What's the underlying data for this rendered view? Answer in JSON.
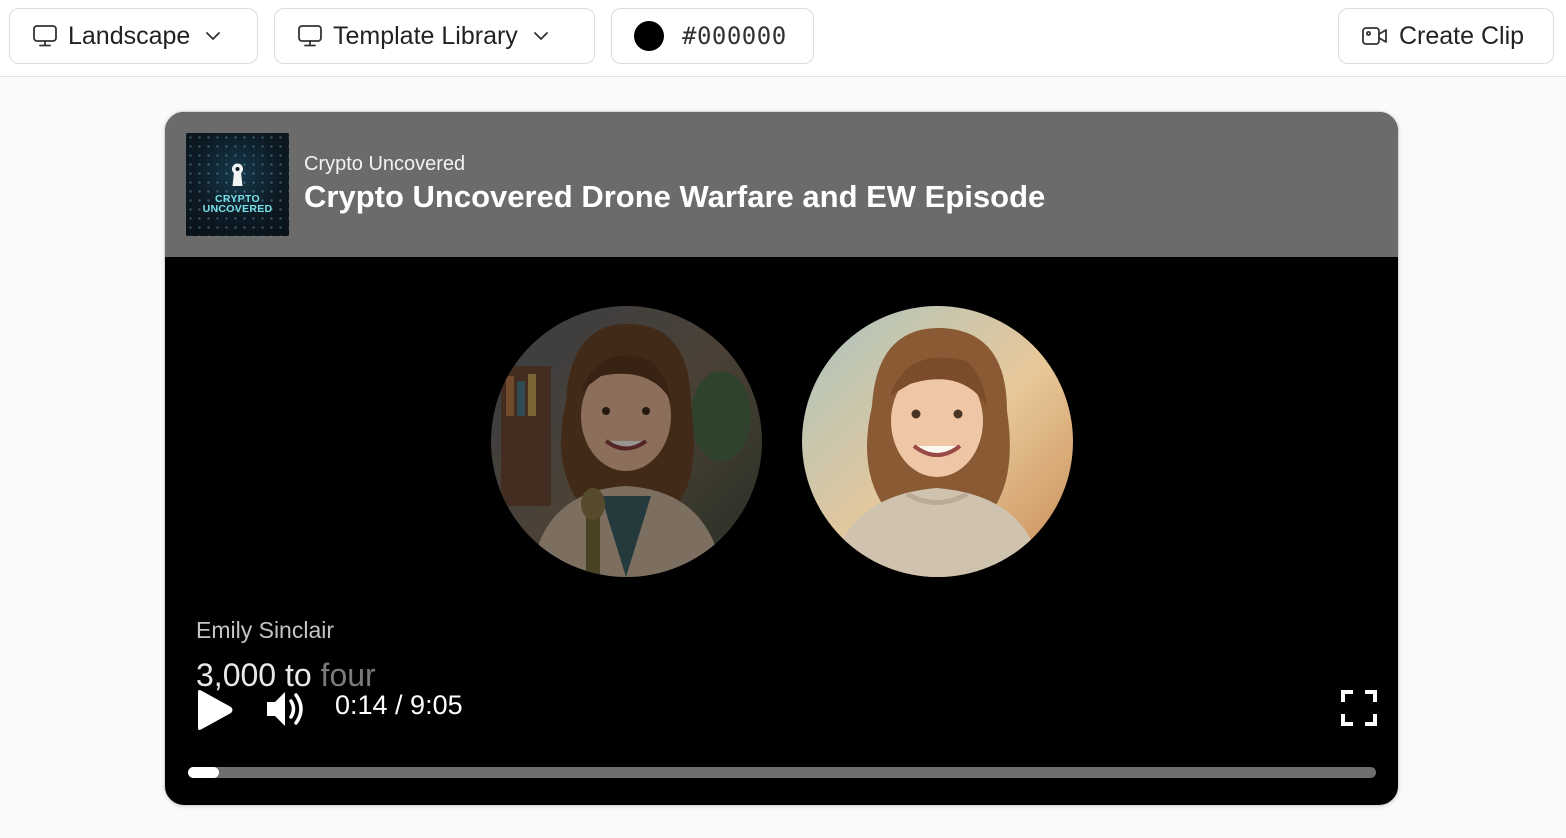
{
  "toolbar": {
    "orientation_label": "Landscape",
    "template_label": "Template Library",
    "color_value": "#000000",
    "create_label": "Create Clip"
  },
  "player": {
    "podcast_name": "Crypto Uncovered",
    "episode_title": "Crypto Uncovered Drone Warfare and EW Episode",
    "cover_art_text": [
      "CRYPTO",
      "UNCOVERED"
    ],
    "speaker_name": "Emily Sinclair",
    "caption_spoken": "3,000 to",
    "caption_pending": " four",
    "time_display": "0:14 / 9:05",
    "progress_fraction": 0.026,
    "header_color": "#6b6b6b",
    "background_color": "#000000"
  },
  "icons": {
    "orientation": "monitor-icon",
    "template": "monitor-icon",
    "dropdown": "chevron-down-icon",
    "create": "video-camera-icon",
    "play": "play-icon",
    "volume": "volume-icon",
    "fullscreen": "fullscreen-icon"
  }
}
